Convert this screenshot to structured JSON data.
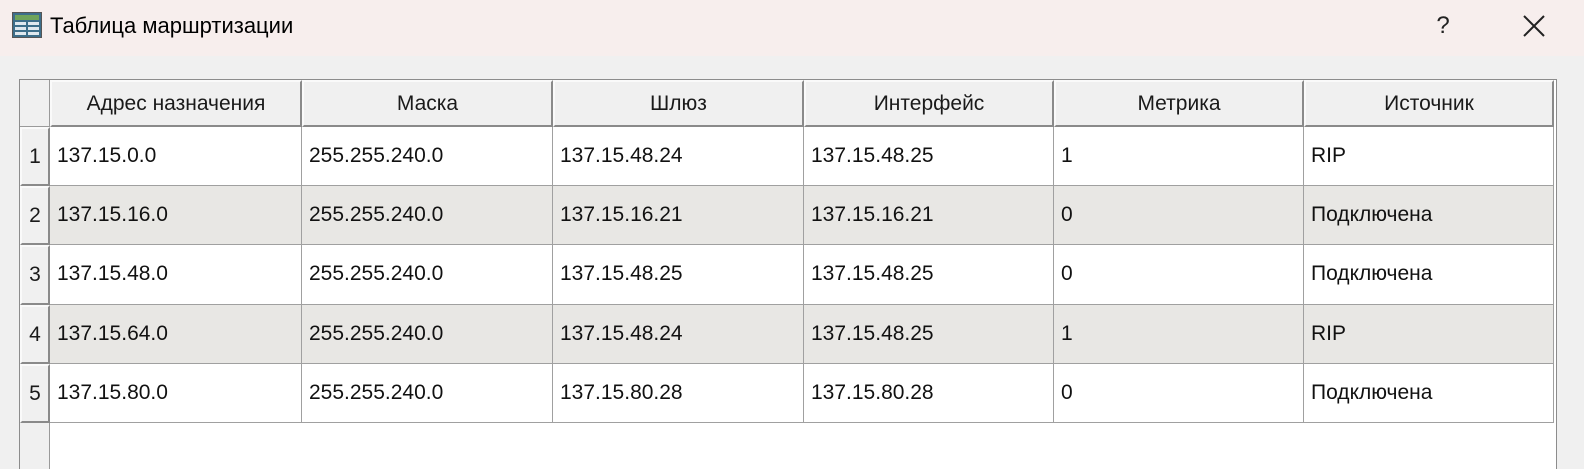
{
  "window": {
    "title": "Таблица маршртизации",
    "help_label": "?",
    "icon": "routing-table-app-icon",
    "close_icon": "close-icon"
  },
  "table": {
    "columns": [
      "Адрес назначения",
      "Маска",
      "Шлюз",
      "Интерфейс",
      "Метрика",
      "Источник"
    ],
    "rows": [
      {
        "num": "1",
        "cells": [
          "137.15.0.0",
          "255.255.240.0",
          "137.15.48.24",
          "137.15.48.25",
          "1",
          "RIP"
        ]
      },
      {
        "num": "2",
        "cells": [
          "137.15.16.0",
          "255.255.240.0",
          "137.15.16.21",
          "137.15.16.21",
          "0",
          "Подключена"
        ]
      },
      {
        "num": "3",
        "cells": [
          "137.15.48.0",
          "255.255.240.0",
          "137.15.48.25",
          "137.15.48.25",
          "0",
          "Подключена"
        ]
      },
      {
        "num": "4",
        "cells": [
          "137.15.64.0",
          "255.255.240.0",
          "137.15.48.24",
          "137.15.48.25",
          "1",
          "RIP"
        ]
      },
      {
        "num": "5",
        "cells": [
          "137.15.80.0",
          "255.255.240.0",
          "137.15.80.28",
          "137.15.80.28",
          "0",
          "Подключена"
        ]
      }
    ]
  },
  "colors": {
    "titlebar_bg": "#f7eeed",
    "window_bg": "#f0f0f0",
    "alt_row_bg": "#e8e7e4",
    "grid_line": "#a0a0a0"
  }
}
